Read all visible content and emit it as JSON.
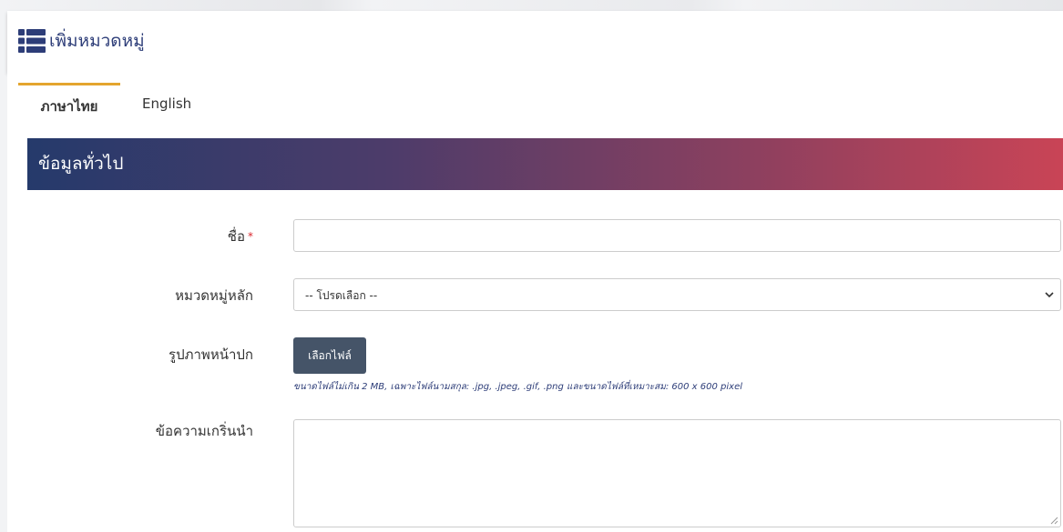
{
  "header": {
    "title": "เพิ่มหมวดหมู่",
    "icon": "list-icon"
  },
  "tabs": [
    {
      "label": "ภาษาไทย",
      "active": true
    },
    {
      "label": "English",
      "active": false
    }
  ],
  "section": {
    "title": "ข้อมูลทั่วไป"
  },
  "form": {
    "name_label": "ชื่อ",
    "required_mark": "*",
    "name_value": "",
    "parent_label": "หมวดหมู่หลัก",
    "parent_selected": "-- โปรดเลือก --",
    "cover_label": "รูปภาพหน้าปก",
    "file_button": "เลือกไฟล์",
    "file_hint": "ขนาดไฟล์ไม่เกิน 2 MB, เฉพาะไฟล์นามสกุล: .jpg, .jpeg, .gif, .png และขนาดไฟล์ที่เหมาะสม: 600 x 600 pixel",
    "intro_label": "ข้อความเกริ่นนำ",
    "intro_value": ""
  },
  "colors": {
    "accent_tab": "#e4a52e",
    "title_text": "#2d3d78",
    "gradient_start": "#253a6b",
    "gradient_end": "#c94456",
    "button_bg": "#455468"
  }
}
